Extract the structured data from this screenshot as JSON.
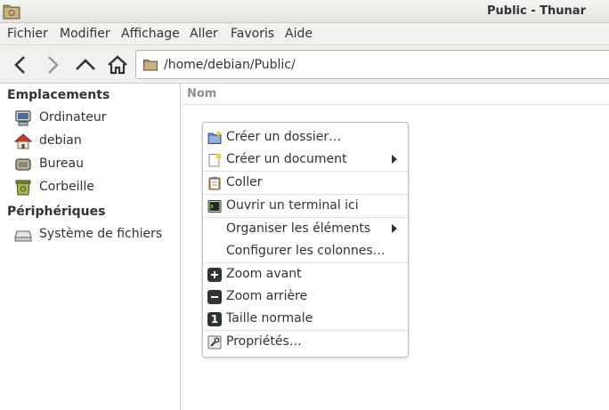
{
  "window": {
    "title": "Public - Thunar",
    "app_icon": "folder-icon"
  },
  "menubar": {
    "items": [
      "Fichier",
      "Modifier",
      "Affichage",
      "Aller",
      "Favoris",
      "Aide"
    ]
  },
  "toolbar": {
    "buttons": [
      "back-icon",
      "forward-icon",
      "up-icon",
      "home-icon"
    ],
    "location": {
      "path": "/home/debian/Public/",
      "icon": "folder-icon"
    }
  },
  "sidebar": {
    "sections": [
      {
        "heading": "Emplacements",
        "items": [
          {
            "label": "Ordinateur",
            "icon": "computer-icon"
          },
          {
            "label": "debian",
            "icon": "home-icon"
          },
          {
            "label": "Bureau",
            "icon": "desktop-icon"
          },
          {
            "label": "Corbeille",
            "icon": "trash-icon"
          }
        ]
      },
      {
        "heading": "Périphériques",
        "items": [
          {
            "label": "Système de fichiers",
            "icon": "drive-icon"
          }
        ]
      }
    ]
  },
  "main": {
    "column_header": "Nom"
  },
  "context_menu": {
    "items": [
      {
        "label": "Créer un dossier…",
        "icon": "new-folder-icon"
      },
      {
        "label": "Créer un document",
        "icon": "new-document-icon",
        "submenu": true
      },
      {
        "label": "Coller",
        "icon": "paste-icon"
      },
      {
        "label": "Ouvrir un terminal ici",
        "icon": "terminal-icon"
      },
      {
        "label": "Organiser les éléments",
        "submenu": true
      },
      {
        "label": "Configurer les colonnes…"
      },
      {
        "label": "Zoom avant",
        "icon": "zoom-in-icon"
      },
      {
        "label": "Zoom arrière",
        "icon": "zoom-out-icon"
      },
      {
        "label": "Taille normale",
        "icon": "zoom-normal-icon",
        "glyph": "1"
      },
      {
        "label": "Propriétés…",
        "icon": "properties-icon"
      }
    ]
  },
  "colors": {
    "accent": "#2e3436",
    "folder": "#a9925f",
    "home_roof": "#cc3a2f"
  }
}
